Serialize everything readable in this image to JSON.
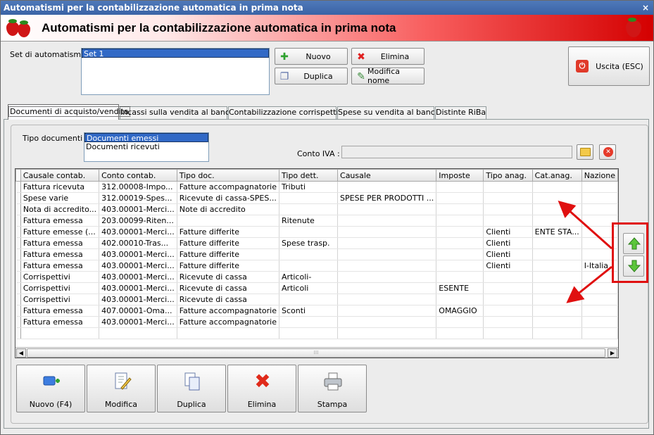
{
  "window": {
    "title": "Automatismi per la contabilizzazione automatica in prima nota",
    "close_glyph": "×"
  },
  "banner": {
    "title": "Automatismi per la contabilizzazione automatica in prima nota",
    "icon": "strawberry-icon"
  },
  "sets": {
    "label": "Set di automatismi :",
    "items": [
      "Set 1"
    ],
    "selected": "Set 1"
  },
  "buttons": {
    "nuovo": "Nuovo",
    "elimina": "Elimina",
    "duplica": "Duplica",
    "modifica_nome": "Modifica nome",
    "uscita": "Uscita (ESC)"
  },
  "tabs": [
    {
      "label": "Documenti di acquisto/vendita",
      "active": true
    },
    {
      "label": "Incassi sulla vendita al banco"
    },
    {
      "label": "Contabilizzazione corrispettivi"
    },
    {
      "label": "Spese su vendita al banco"
    },
    {
      "label": "Distinte RiBa"
    }
  ],
  "tipo_documenti": {
    "label": "Tipo documenti :",
    "items": [
      "Documenti emessi",
      "Documenti ricevuti"
    ],
    "selected": "Documenti emessi"
  },
  "conto_iva": {
    "label": "Conto IVA :",
    "value": ""
  },
  "grid": {
    "columns": [
      "Causale contab.",
      "Conto contab.",
      "Tipo doc.",
      "Tipo dett.",
      "Causale",
      "Imposte",
      "Tipo anag.",
      "Cat.anag.",
      "Nazione"
    ],
    "rows": [
      [
        "Fattura ricevuta",
        "312.00008-Impo...",
        "Fatture accompagnatorie",
        "Tributi",
        "",
        "",
        "",
        "",
        ""
      ],
      [
        "Spese varie",
        "312.00019-Spes...",
        "Ricevute di cassa-SPES...",
        "",
        "SPESE PER PRODOTTI ...",
        "",
        "",
        "",
        ""
      ],
      [
        "Nota di accredito...",
        "403.00001-Merci...",
        "Note di accredito",
        "",
        "",
        "",
        "",
        "",
        ""
      ],
      [
        "Fattura emessa",
        "203.00099-Riten...",
        "",
        "Ritenute",
        "",
        "",
        "",
        "",
        ""
      ],
      [
        "Fatture emesse (...",
        "403.00001-Merci...",
        "Fatture differite",
        "",
        "",
        "",
        "Clienti",
        "ENTE STA...",
        ""
      ],
      [
        "Fattura emessa",
        "402.00010-Tras...",
        "Fatture differite",
        "Spese trasp.",
        "",
        "",
        "Clienti",
        "",
        ""
      ],
      [
        "Fattura emessa",
        "403.00001-Merci...",
        "Fatture differite",
        "",
        "",
        "",
        "Clienti",
        "",
        ""
      ],
      [
        "Fattura emessa",
        "403.00001-Merci...",
        "Fatture differite",
        "",
        "",
        "",
        "Clienti",
        "",
        "I-Italia"
      ],
      [
        "Corrispettivi",
        "403.00001-Merci...",
        "Ricevute di cassa",
        "Articoli-",
        "",
        "",
        "",
        "",
        ""
      ],
      [
        "Corrispettivi",
        "403.00001-Merci...",
        "Ricevute di cassa",
        "Articoli",
        "",
        "ESENTE",
        "",
        "",
        ""
      ],
      [
        "Corrispettivi",
        "403.00001-Merci...",
        "Ricevute di cassa",
        "",
        "",
        "",
        "",
        "",
        ""
      ],
      [
        "Fattura emessa",
        "407.00001-Oma...",
        "Fatture accompagnatorie",
        "Sconti",
        "",
        "OMAGGIO",
        "",
        "",
        ""
      ],
      [
        "Fattura emessa",
        "403.00001-Merci...",
        "Fatture accompagnatorie",
        "",
        "",
        "",
        "",
        "",
        ""
      ]
    ]
  },
  "move": {
    "up_icon": "green-arrow-up-icon",
    "down_icon": "green-arrow-down-icon"
  },
  "bottom_buttons": {
    "nuovo": "Nuovo (F4)",
    "modifica": "Modifica",
    "duplica": "Duplica",
    "elimina": "Elimina",
    "stampa": "Stampa"
  },
  "colors": {
    "accent_red": "#e01010",
    "selection_blue": "#3169c6",
    "title_blue": "#3a63a6"
  }
}
